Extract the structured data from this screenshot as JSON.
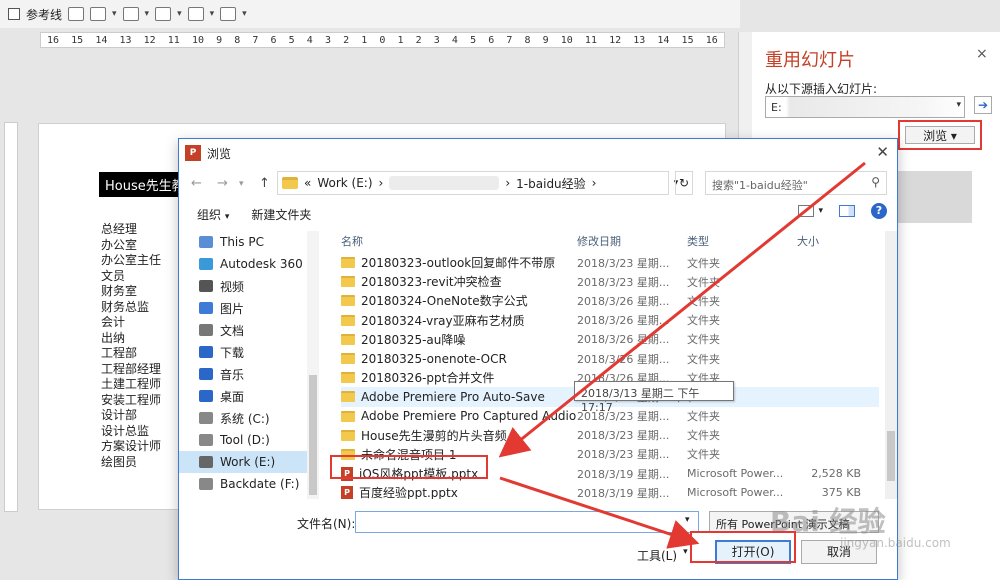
{
  "ribbon": {
    "guides_label": "参考线"
  },
  "ruler": {
    "ticks": [
      "16",
      "15",
      "14",
      "13",
      "12",
      "11",
      "10",
      "9",
      "8",
      "7",
      "6",
      "5",
      "4",
      "3",
      "2",
      "1",
      "0",
      "1",
      "2",
      "3",
      "4",
      "5",
      "6",
      "7",
      "8",
      "9",
      "10",
      "11",
      "12",
      "13",
      "14",
      "15",
      "16"
    ]
  },
  "slide": {
    "title": "House先生教",
    "items": [
      "总经理",
      "办公室",
      "办公室主任",
      "文员",
      "财务室",
      "财务总监",
      "会计",
      "出纳",
      "工程部",
      "工程部经理",
      "土建工程师",
      "安装工程师",
      "设计部",
      "设计总监",
      "方案设计师",
      "绘图员"
    ]
  },
  "pane": {
    "title": "重用幻灯片",
    "close": "×",
    "source_label": "从以下源插入幻灯片:",
    "path_prefix": "E:",
    "browse_label": "浏览 ▾"
  },
  "dialog": {
    "title": "浏览",
    "close": "✕",
    "address": {
      "overflow": "«",
      "drive": "Work (E:)",
      "sep": "›",
      "folder": "1-baidu经验"
    },
    "search_placeholder": "搜索\"1-baidu经验\"",
    "toolbar": {
      "organize": "组织",
      "new_folder": "新建文件夹"
    },
    "nav": [
      "This PC",
      "Autodesk 360",
      "视频",
      "图片",
      "文档",
      "下载",
      "音乐",
      "桌面",
      "系统 (C:)",
      "Tool (D:)",
      "Work (E:)",
      "Backdate (F:)"
    ],
    "nav_selected": "Work (E:)",
    "columns": {
      "name": "名称",
      "date": "修改日期",
      "type": "类型",
      "size": "大小"
    },
    "rows": [
      {
        "name": "20180323-outlook回复邮件不带原",
        "date": "2018/3/23 星期...",
        "type": "文件夹",
        "size": "",
        "kind": "folder"
      },
      {
        "name": "20180323-revit冲突检查",
        "date": "2018/3/23 星期...",
        "type": "文件夹",
        "size": "",
        "kind": "folder"
      },
      {
        "name": "20180324-OneNote数字公式",
        "date": "2018/3/26 星期...",
        "type": "文件夹",
        "size": "",
        "kind": "folder"
      },
      {
        "name": "20180324-vray亚麻布艺材质",
        "date": "2018/3/26 星期...",
        "type": "文件夹",
        "size": "",
        "kind": "folder"
      },
      {
        "name": "20180325-au降噪",
        "date": "2018/3/26 星期...",
        "type": "文件夹",
        "size": "",
        "kind": "folder"
      },
      {
        "name": "20180325-onenote-OCR",
        "date": "2018/3/26 星期...",
        "type": "文件夹",
        "size": "",
        "kind": "folder"
      },
      {
        "name": "20180326-ppt合并文件",
        "date": "2018/3/26 星期...",
        "type": "文件夹",
        "size": "",
        "kind": "folder"
      },
      {
        "name": "Adobe Premiere Pro Auto-Save",
        "date": "2018/3/13 星期二 下午 17:17",
        "type": "",
        "size": "",
        "kind": "folder"
      },
      {
        "name": "Adobe Premiere Pro Captured Audio",
        "date": "2018/3/23 星期...",
        "type": "文件夹",
        "size": "",
        "kind": "folder"
      },
      {
        "name": "House先生漫剪的片头音频",
        "date": "2018/3/23 星期...",
        "type": "文件夹",
        "size": "",
        "kind": "folder"
      },
      {
        "name": "未命名混音项目 1",
        "date": "2018/3/23 星期...",
        "type": "文件夹",
        "size": "",
        "kind": "folder"
      },
      {
        "name": "iOS风格ppt模板.pptx",
        "date": "2018/3/19 星期...",
        "type": "Microsoft Power...",
        "size": "2,528 KB",
        "kind": "pptx"
      },
      {
        "name": "百度经验ppt.pptx",
        "date": "2018/3/19 星期...",
        "type": "Microsoft Power...",
        "size": "375 KB",
        "kind": "pptx"
      }
    ],
    "tooltip": "2018/3/13 星期二 下午 17:17",
    "filename_label": "文件名(N):",
    "filename_value": "",
    "filter": "所有 PowerPoint 演示文稿",
    "tools": "工具(L)",
    "open": "打开(O)",
    "cancel": "取消"
  },
  "watermark": {
    "text": "Bai 经验",
    "sub": "jingyan.baidu.com"
  },
  "colors": {
    "accent_red": "#e23a32",
    "title_orange": "#c44127",
    "select_blue": "#cce4f7"
  }
}
